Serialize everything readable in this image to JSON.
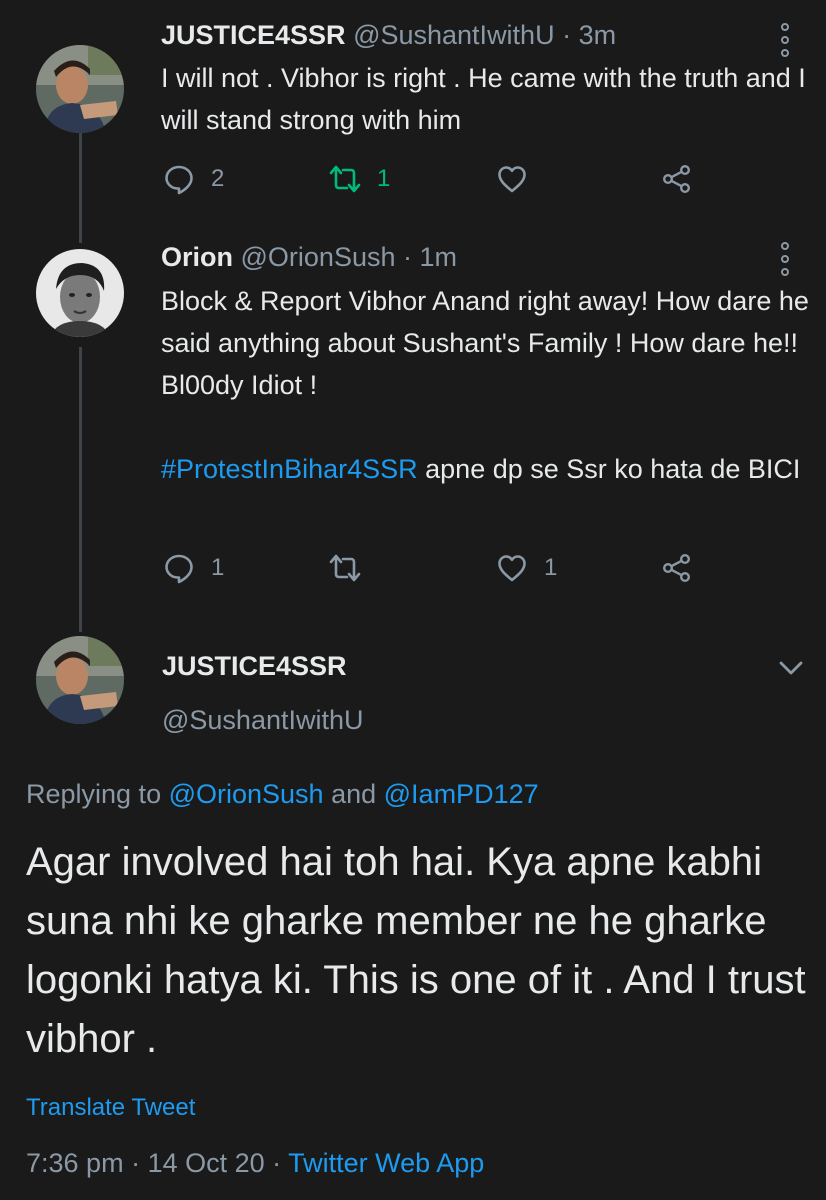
{
  "colors": {
    "background": "#1a1a1a",
    "text": "#e7e9ea",
    "muted": "#8b98a5",
    "link": "#1d9bf0",
    "retweet_active": "#00ba7c"
  },
  "tweet1": {
    "name": "JUSTICE4SSR",
    "handle": "@SushantIwithU",
    "separator": "·",
    "time": "3m",
    "text": "I will not . Vibhor is right . He came with the truth and I will stand strong with him",
    "reply_count": "2",
    "retweet_count": "1",
    "retweeted": true,
    "like_count": ""
  },
  "tweet2": {
    "name": "Orion",
    "handle": "@OrionSush",
    "separator": "·",
    "time": "1m",
    "text_line1": "Block & Report Vibhor Anand right away! How dare he said anything about Sushant's Family ! How dare he!! Bl00dy Idiot !",
    "hashtag": "#ProtestInBihar4SSR",
    "text_line2": " apne dp se Ssr ko hata de BICI",
    "reply_count": "1",
    "retweet_count": "",
    "like_count": "1"
  },
  "main_tweet": {
    "name": "JUSTICE4SSR",
    "handle": "@SushantIwithU",
    "replying_prefix": "Replying to ",
    "mention1": "@OrionSush",
    "replying_and": " and ",
    "mention2": "@IamPD127",
    "text": "Agar involved hai toh hai. Kya apne kabhi suna nhi ke gharke member ne he gharke logonki hatya ki. This is one of it . And I trust vibhor .",
    "translate_label": "Translate Tweet",
    "time": "7:36 pm",
    "separator": " · ",
    "date": "14 Oct 20",
    "app": "Twitter Web App"
  },
  "icons": {
    "reply": "reply-bubble-icon",
    "retweet": "retweet-arrows-icon",
    "like": "heart-icon",
    "share": "share-nodes-icon",
    "more": "vertical-dots-icon",
    "chevron": "chevron-down-icon"
  }
}
